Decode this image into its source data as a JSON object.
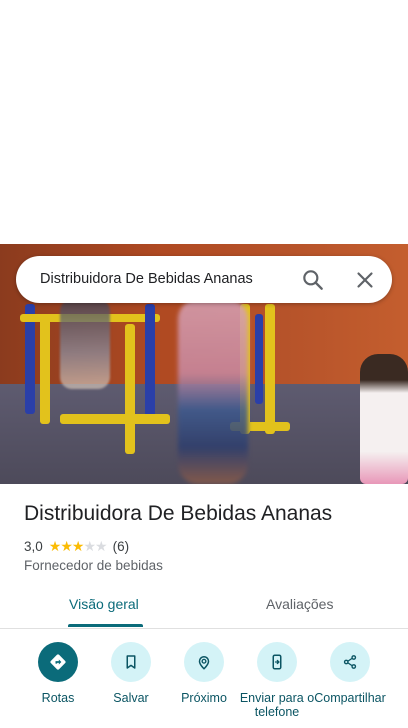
{
  "search": {
    "query": "Distribuidora De Bebidas Ananas"
  },
  "place": {
    "name": "Distribuidora De Bebidas Ananas",
    "rating": "3,0",
    "stars_filled": 3,
    "stars_total": 5,
    "review_count": "(6)",
    "category": "Fornecedor de bebidas"
  },
  "tabs": {
    "overview": "Visão geral",
    "reviews": "Avaliações",
    "active": "overview"
  },
  "actions": [
    {
      "label": "Rotas",
      "icon": "directions-icon"
    },
    {
      "label": "Salvar",
      "icon": "bookmark-icon"
    },
    {
      "label": "Próximo",
      "icon": "nearby-icon"
    },
    {
      "label": "Enviar para o telefone",
      "icon": "send-to-phone-icon"
    },
    {
      "label": "Compartilhar",
      "icon": "share-icon"
    }
  ],
  "colors": {
    "accent": "#0b6b7a",
    "accent_light": "#d4f3f7",
    "star": "#fbbc04"
  }
}
